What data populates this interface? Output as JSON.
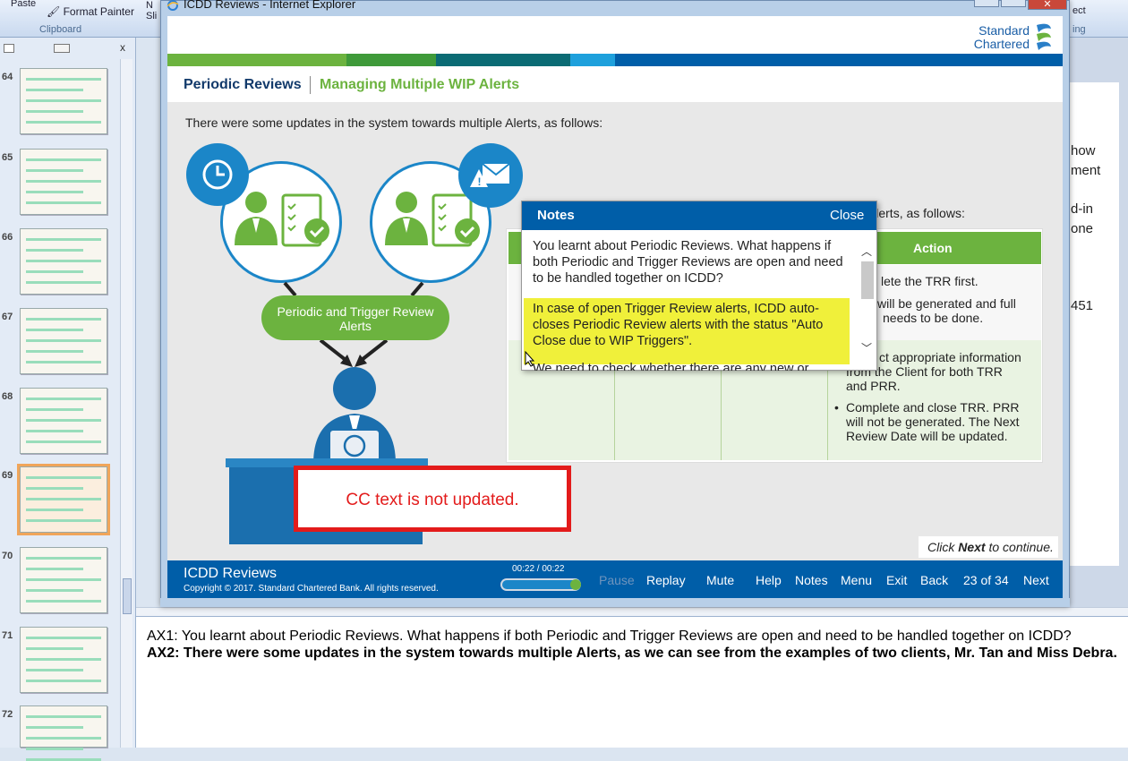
{
  "ribbon": {
    "paste": "Paste",
    "format_painter": "Format Painter",
    "clipboard": "Clipboard",
    "right_top": "ect",
    "right_bottom": "ing",
    "ns_top": "N",
    "ns_bottom": "Sli"
  },
  "slides_panel": {
    "numbers": [
      "64",
      "65",
      "66",
      "67",
      "68",
      "69",
      "70",
      "71",
      "72"
    ],
    "selected": "69",
    "close": "x"
  },
  "doc_right": {
    "lines": [
      "how",
      "ment",
      "d-in",
      "one",
      "451"
    ]
  },
  "ie": {
    "title": "ICDD Reviews - Internet Explorer"
  },
  "course": {
    "logo": "Standard Chartered",
    "breadcrumb_1": "Periodic Reviews",
    "breadcrumb_2": "Managing Multiple WIP Alerts",
    "intro": "There were some updates in the system towards multiple Alerts, as follows:",
    "pill": "Periodic and Trigger Review Alerts",
    "alerts_label": "e Alerts, as follows:",
    "table_header_action": "Action",
    "row1_text_a": "lete the TRR first.",
    "row1_text_b": "will be generated and full",
    "row1_text_c": "needs to be done.",
    "row2_text_a": "ct appropriate information",
    "row2_text_b": "from the Client for both TRR",
    "row2_text_c": "and PRR.",
    "row2_bullet": "•",
    "row2_text_d": "Complete and close TRR. PRR",
    "row2_text_e": "will not be generated. The Next",
    "row2_text_f": "Review Date will be updated.",
    "notes": {
      "title": "Notes",
      "close": "Close",
      "para1": "You learnt about Periodic Reviews. What happens if both Periodic and Trigger Reviews are open and need to be handled together on ICDD?",
      "para2": "In case of open Trigger Review alerts, ICDD auto-closes Periodic Review alerts with the status \"Auto Close due to WIP Triggers\".",
      "para3": "We need to check whether there are any new or"
    },
    "cc_text": "CC text is not updated.",
    "click_next_pre": "Click ",
    "click_next_bold": "Next",
    "click_next_post": " to continue.",
    "footer": {
      "title": "ICDD Reviews",
      "copyright": "Copyright © 2017. Standard Chartered Bank. All rights reserved.",
      "time": "00:22 / 00:22",
      "progress": 1.0,
      "buttons": [
        "Pause",
        "Replay",
        "Mute",
        "Help",
        "Notes",
        "Menu",
        "Exit",
        "Back",
        "23 of 34",
        "Next"
      ]
    }
  },
  "notes_pane": {
    "ax1": "AX1: You learnt about Periodic Reviews. What happens if both Periodic and Trigger Reviews are open and need to be handled together on ICDD?",
    "ax2": "AX2: There were some updates in the system towards multiple Alerts, as we can see from the examples of two clients, Mr. Tan and Miss Debra."
  },
  "colors": {
    "brand_blue": "#005ea8",
    "brand_green": "#6cb33f",
    "accent_blue": "#1b86c8",
    "highlight_yellow": "#f0f03a",
    "cc_red": "#e31b1b"
  }
}
